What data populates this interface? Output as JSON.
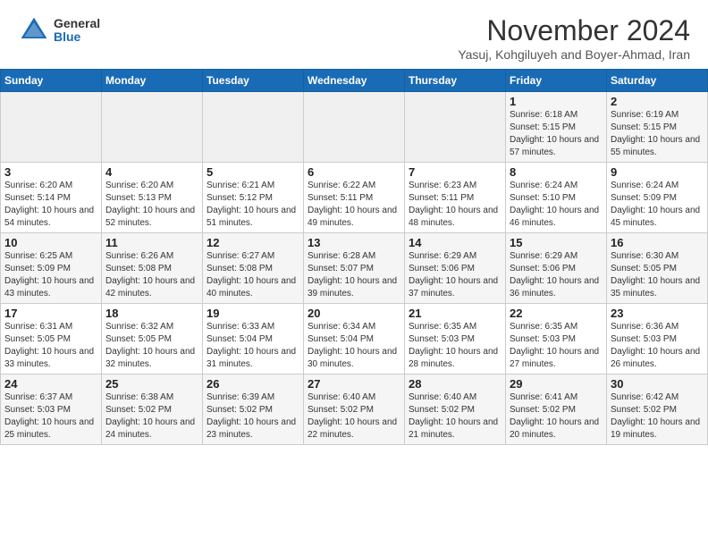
{
  "header": {
    "logo_general": "General",
    "logo_blue": "Blue",
    "month_title": "November 2024",
    "subtitle": "Yasuj, Kohgiluyeh and Boyer-Ahmad, Iran"
  },
  "days_of_week": [
    "Sunday",
    "Monday",
    "Tuesday",
    "Wednesday",
    "Thursday",
    "Friday",
    "Saturday"
  ],
  "weeks": [
    [
      {
        "day": "",
        "info": ""
      },
      {
        "day": "",
        "info": ""
      },
      {
        "day": "",
        "info": ""
      },
      {
        "day": "",
        "info": ""
      },
      {
        "day": "",
        "info": ""
      },
      {
        "day": "1",
        "info": "Sunrise: 6:18 AM\nSunset: 5:15 PM\nDaylight: 10 hours and 57 minutes."
      },
      {
        "day": "2",
        "info": "Sunrise: 6:19 AM\nSunset: 5:15 PM\nDaylight: 10 hours and 55 minutes."
      }
    ],
    [
      {
        "day": "3",
        "info": "Sunrise: 6:20 AM\nSunset: 5:14 PM\nDaylight: 10 hours and 54 minutes."
      },
      {
        "day": "4",
        "info": "Sunrise: 6:20 AM\nSunset: 5:13 PM\nDaylight: 10 hours and 52 minutes."
      },
      {
        "day": "5",
        "info": "Sunrise: 6:21 AM\nSunset: 5:12 PM\nDaylight: 10 hours and 51 minutes."
      },
      {
        "day": "6",
        "info": "Sunrise: 6:22 AM\nSunset: 5:11 PM\nDaylight: 10 hours and 49 minutes."
      },
      {
        "day": "7",
        "info": "Sunrise: 6:23 AM\nSunset: 5:11 PM\nDaylight: 10 hours and 48 minutes."
      },
      {
        "day": "8",
        "info": "Sunrise: 6:24 AM\nSunset: 5:10 PM\nDaylight: 10 hours and 46 minutes."
      },
      {
        "day": "9",
        "info": "Sunrise: 6:24 AM\nSunset: 5:09 PM\nDaylight: 10 hours and 45 minutes."
      }
    ],
    [
      {
        "day": "10",
        "info": "Sunrise: 6:25 AM\nSunset: 5:09 PM\nDaylight: 10 hours and 43 minutes."
      },
      {
        "day": "11",
        "info": "Sunrise: 6:26 AM\nSunset: 5:08 PM\nDaylight: 10 hours and 42 minutes."
      },
      {
        "day": "12",
        "info": "Sunrise: 6:27 AM\nSunset: 5:08 PM\nDaylight: 10 hours and 40 minutes."
      },
      {
        "day": "13",
        "info": "Sunrise: 6:28 AM\nSunset: 5:07 PM\nDaylight: 10 hours and 39 minutes."
      },
      {
        "day": "14",
        "info": "Sunrise: 6:29 AM\nSunset: 5:06 PM\nDaylight: 10 hours and 37 minutes."
      },
      {
        "day": "15",
        "info": "Sunrise: 6:29 AM\nSunset: 5:06 PM\nDaylight: 10 hours and 36 minutes."
      },
      {
        "day": "16",
        "info": "Sunrise: 6:30 AM\nSunset: 5:05 PM\nDaylight: 10 hours and 35 minutes."
      }
    ],
    [
      {
        "day": "17",
        "info": "Sunrise: 6:31 AM\nSunset: 5:05 PM\nDaylight: 10 hours and 33 minutes."
      },
      {
        "day": "18",
        "info": "Sunrise: 6:32 AM\nSunset: 5:05 PM\nDaylight: 10 hours and 32 minutes."
      },
      {
        "day": "19",
        "info": "Sunrise: 6:33 AM\nSunset: 5:04 PM\nDaylight: 10 hours and 31 minutes."
      },
      {
        "day": "20",
        "info": "Sunrise: 6:34 AM\nSunset: 5:04 PM\nDaylight: 10 hours and 30 minutes."
      },
      {
        "day": "21",
        "info": "Sunrise: 6:35 AM\nSunset: 5:03 PM\nDaylight: 10 hours and 28 minutes."
      },
      {
        "day": "22",
        "info": "Sunrise: 6:35 AM\nSunset: 5:03 PM\nDaylight: 10 hours and 27 minutes."
      },
      {
        "day": "23",
        "info": "Sunrise: 6:36 AM\nSunset: 5:03 PM\nDaylight: 10 hours and 26 minutes."
      }
    ],
    [
      {
        "day": "24",
        "info": "Sunrise: 6:37 AM\nSunset: 5:03 PM\nDaylight: 10 hours and 25 minutes."
      },
      {
        "day": "25",
        "info": "Sunrise: 6:38 AM\nSunset: 5:02 PM\nDaylight: 10 hours and 24 minutes."
      },
      {
        "day": "26",
        "info": "Sunrise: 6:39 AM\nSunset: 5:02 PM\nDaylight: 10 hours and 23 minutes."
      },
      {
        "day": "27",
        "info": "Sunrise: 6:40 AM\nSunset: 5:02 PM\nDaylight: 10 hours and 22 minutes."
      },
      {
        "day": "28",
        "info": "Sunrise: 6:40 AM\nSunset: 5:02 PM\nDaylight: 10 hours and 21 minutes."
      },
      {
        "day": "29",
        "info": "Sunrise: 6:41 AM\nSunset: 5:02 PM\nDaylight: 10 hours and 20 minutes."
      },
      {
        "day": "30",
        "info": "Sunrise: 6:42 AM\nSunset: 5:02 PM\nDaylight: 10 hours and 19 minutes."
      }
    ]
  ]
}
